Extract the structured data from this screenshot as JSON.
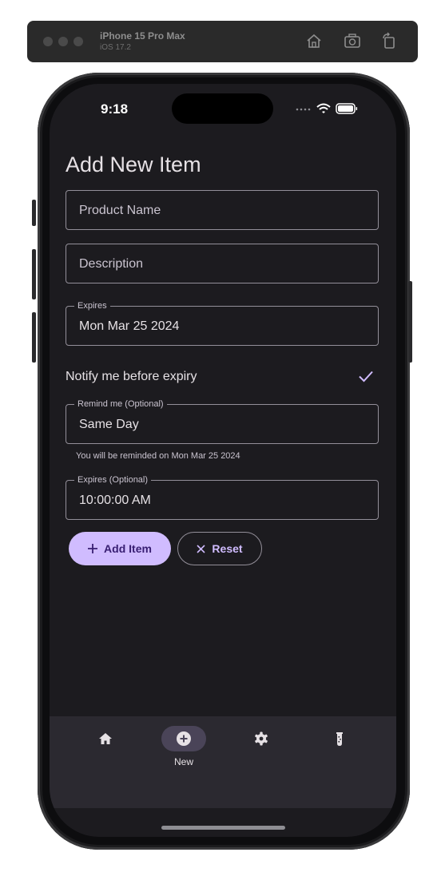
{
  "simulator": {
    "device": "iPhone 15 Pro Max",
    "os": "iOS 17.2",
    "icons": [
      "home-icon",
      "screenshot-icon",
      "rotate-icon"
    ]
  },
  "status_bar": {
    "time": "9:18",
    "icons": [
      "signal-dots-icon",
      "wifi-icon",
      "battery-icon"
    ]
  },
  "page": {
    "title": "Add New Item"
  },
  "form": {
    "product_name_placeholder": "Product Name",
    "description_placeholder": "Description",
    "expires_label": "Expires",
    "expires_value": "Mon Mar 25 2024",
    "notify_label": "Notify me before expiry",
    "notify_checked": true,
    "remind_label": "Remind me (Optional)",
    "remind_value": "Same Day",
    "remind_helper": "You will be reminded on Mon Mar 25 2024",
    "expires_time_label": "Expires (Optional)",
    "expires_time_value": "10:00:00 AM"
  },
  "actions": {
    "add_label": "Add Item",
    "reset_label": "Reset"
  },
  "bottom_nav": {
    "items": [
      {
        "icon": "home-icon",
        "label": "",
        "active": false
      },
      {
        "icon": "add-circle-icon",
        "label": "New",
        "active": true
      },
      {
        "icon": "settings-gear-icon",
        "label": "",
        "active": false
      },
      {
        "icon": "flask-icon",
        "label": "",
        "active": false
      }
    ]
  },
  "colors": {
    "background": "#1c1b1f",
    "primary": "#d0bcff",
    "on_primary": "#381e72",
    "outline": "#938f99",
    "nav_bar": "#2b2930",
    "nav_indicator": "#4a4458"
  }
}
